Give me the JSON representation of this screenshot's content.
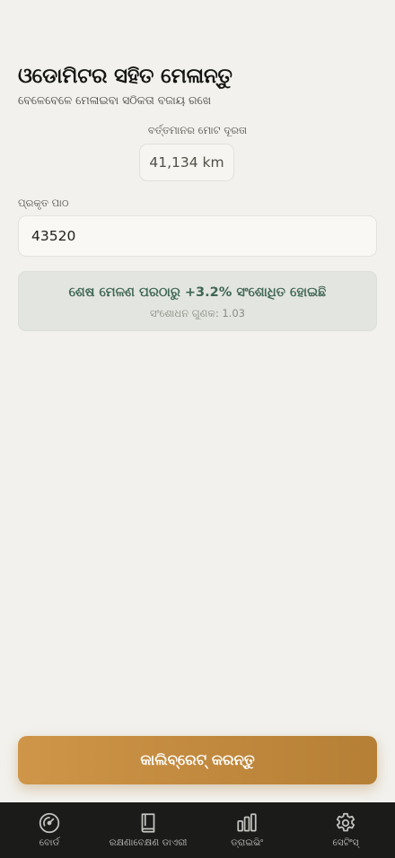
{
  "header": {
    "title": "ଓଡୋମିଟର ସହିତ ମେଳାନ୍ତୁ",
    "subtitle": "ବେଳେବେଳେ ମେଳାଇବା ସଠିକତା ବଜାୟ ରଖେ"
  },
  "odometer": {
    "label": "ବର୍ତ୍ତମାନର ମୋଟ ଦୂରତା",
    "value": "41,134 km"
  },
  "reading": {
    "label": "ପ୍ରକୃତ ପାଠ",
    "value": "43520"
  },
  "correction": {
    "message": "ଶେଷ ମେଳଣ ପରଠାରୁ +3.2% ସଂଶୋଧିତ ହୋଇଛି",
    "detail": "ସଂଶୋଧନ ଗୁଣକ: 1.03"
  },
  "actions": {
    "calibrate_label": "କାଲିବ୍ରେଟ୍ କରନ୍ତୁ"
  },
  "tabs": [
    {
      "label": "ବୋର୍ଡ",
      "icon": "gauge-icon"
    },
    {
      "label": "ରକ୍ଷଣାବେକ୍ଷଣ ଡାଏରୀ",
      "icon": "book-icon"
    },
    {
      "label": "ଡ୍ରାଇଭିଂ",
      "icon": "bar-chart-icon"
    },
    {
      "label": "ସେଟିଂସ୍",
      "icon": "gear-icon"
    }
  ],
  "colors": {
    "accent": "#c58c42",
    "positive_text": "#3e6653",
    "tabbar_bg": "#1b1b1a"
  }
}
